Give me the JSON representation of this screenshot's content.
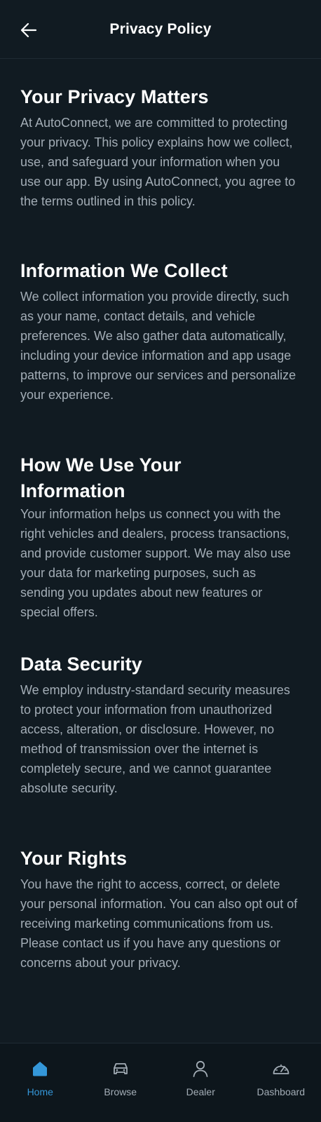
{
  "header": {
    "title": "Privacy Policy",
    "back_icon": "arrow-left-icon"
  },
  "sections": [
    {
      "title": "Your Privacy Matters",
      "body": "At AutoConnect, we are committed to protecting your privacy. This policy explains how we collect, use, and safeguard your information when you use our app. By using AutoConnect, you agree to the terms outlined in this policy."
    },
    {
      "title": "Information We Collect",
      "body": "We collect information you provide directly, such as your name, contact details, and vehicle preferences. We also gather data automatically, including your device information and app usage patterns, to improve our services and personalize your experience."
    },
    {
      "title": "How We Use Your Information",
      "body": "Your information helps us connect you with the right vehicles and dealers, process transactions, and provide customer support. We may also use your data for marketing purposes, such as sending you updates about new features or special offers."
    },
    {
      "title": "Data Security",
      "body": "We employ industry-standard security measures to protect your information from unauthorized access, alteration, or disclosure. However, no method of transmission over the internet is completely secure, and we cannot guarantee absolute security."
    },
    {
      "title": "Your Rights",
      "body": "You have the right to access, correct, or delete your personal information. You can also opt out of receiving marketing communications from us. Please contact us if you have any questions or concerns about your privacy."
    }
  ],
  "bottom_nav": {
    "items": [
      {
        "label": "Home",
        "icon": "home-icon",
        "active": true
      },
      {
        "label": "Browse",
        "icon": "car-icon",
        "active": false
      },
      {
        "label": "Dealer",
        "icon": "user-icon",
        "active": false
      },
      {
        "label": "Dashboard",
        "icon": "speedometer-icon",
        "active": false
      }
    ]
  },
  "colors": {
    "background": "#111b22",
    "nav_background": "#0d161c",
    "body_text": "#a3adb6",
    "accent": "#3497d9"
  }
}
